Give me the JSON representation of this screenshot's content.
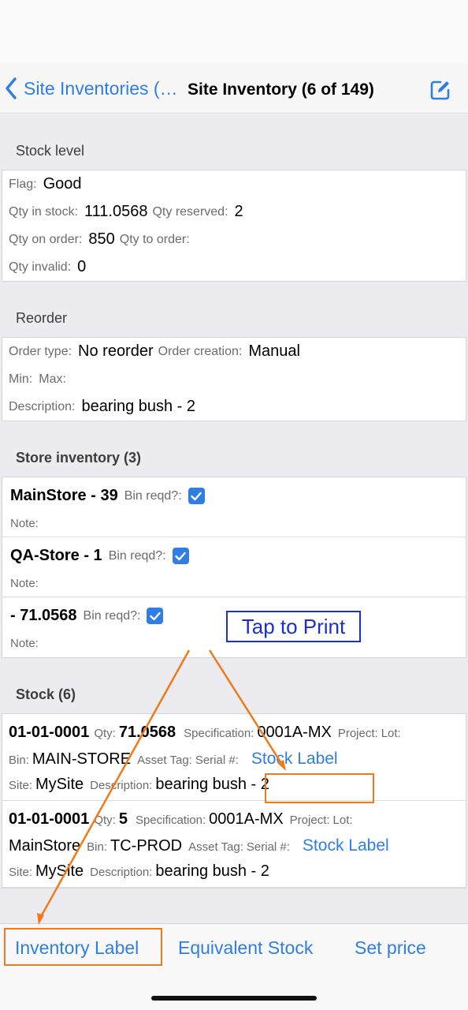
{
  "nav": {
    "back_label": "Site Inventories (…",
    "title": "Site Inventory (6 of 149)",
    "edit_icon": "compose-icon"
  },
  "stock_level": {
    "header": "Stock level",
    "flag_label": "Flag:",
    "flag": "Good",
    "qty_in_stock_label": "Qty in stock:",
    "qty_in_stock": "111.0568",
    "qty_reserved_label": "Qty reserved:",
    "qty_reserved": "2",
    "qty_on_order_label": "Qty on order:",
    "qty_on_order": "850",
    "qty_to_order_label": "Qty to order:",
    "qty_invalid_label": "Qty invalid:",
    "qty_invalid": "0"
  },
  "reorder": {
    "header": "Reorder",
    "order_type_label": "Order type:",
    "order_type": "No reorder",
    "order_creation_label": "Order creation:",
    "order_creation": "Manual",
    "min_label": "Min:",
    "max_label": "Max:",
    "description_label": "Description:",
    "description": "bearing bush - 2"
  },
  "store_inventory": {
    "header": "Store inventory (3)",
    "bin_label": "Bin reqd?:",
    "note_label": "Note:",
    "items": [
      {
        "name": "MainStore - 39",
        "bin_reqd": true
      },
      {
        "name": "QA-Store - 1",
        "bin_reqd": true
      },
      {
        "name": "- 71.0568",
        "bin_reqd": true
      }
    ]
  },
  "stock": {
    "header": "Stock (6)",
    "labels": {
      "qty": "Qty:",
      "specification": "Specification:",
      "project": "Project:",
      "lot": "Lot:",
      "bin": "Bin:",
      "asset_tag": "Asset Tag:",
      "serial": "Serial #:",
      "site": "Site:",
      "description": "Description:"
    },
    "link_label": "Stock Label",
    "items": [
      {
        "code": "01-01-0001",
        "qty": "71.0568",
        "specification": "0001A-MX",
        "lot_value": "",
        "bin": "MAIN-STORE",
        "site": "MySite",
        "description": "bearing bush - 2"
      },
      {
        "code": "01-01-0001",
        "qty": "5",
        "specification": "0001A-MX",
        "lot_value": "MainStore",
        "bin": "TC-PROD",
        "site": "MySite",
        "description": "bearing bush - 2"
      }
    ]
  },
  "bottom_bar": {
    "inventory_label": "Inventory Label",
    "equivalent_stock": "Equivalent Stock",
    "set_price": "Set price"
  },
  "annotation": {
    "tap_to_print": "Tap to Print",
    "color": "#f07a1a",
    "box_color": "#1a2ed8"
  },
  "colors": {
    "accent": "#2f7ee3",
    "background": "#ececf0"
  }
}
